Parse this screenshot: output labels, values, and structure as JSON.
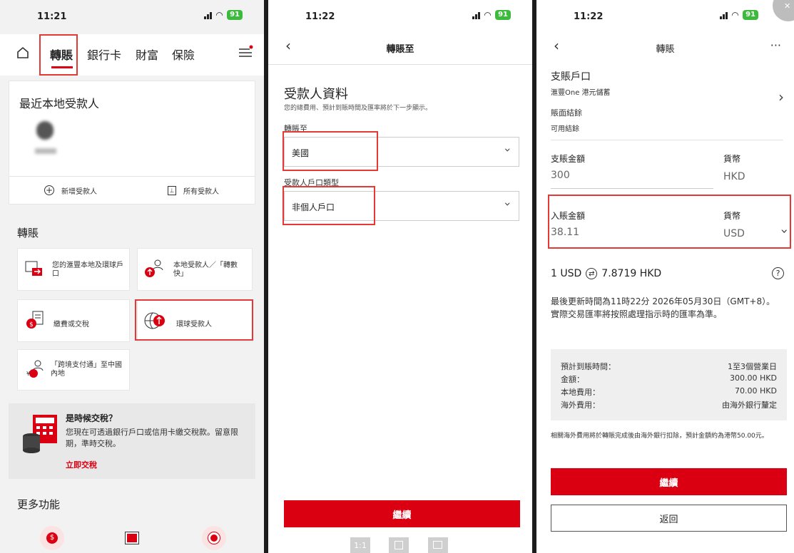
{
  "screen1": {
    "status_time": "11:21",
    "battery": "91",
    "tabs": [
      "轉賬",
      "銀行卡",
      "財富",
      "保險"
    ],
    "recent_title": "最近本地受款人",
    "add_payee": "新增受款人",
    "all_payees": "所有受款人",
    "section_title": "轉賬",
    "tiles": [
      "您的滙豐本地及環球戶口",
      "本地受款人／「轉數快」",
      "繳費或交稅",
      "環球受款人",
      "「跨境支付通」至中國內地"
    ],
    "promo_title": "是時候交稅？",
    "promo_text": "您現在可透過銀行戶口或信用卡繳交稅款。留意限期，準時交稅。",
    "promo_link": "立即交稅",
    "more_title": "更多功能"
  },
  "screen2": {
    "status_time": "11:22",
    "battery": "91",
    "header_title": "轉賬至",
    "section_title": "受款人資料",
    "section_subtitle": "您的總費用、預計到賬時間及匯率將於下一步顯示。",
    "to_label": "轉賬至",
    "to_value": "美國",
    "account_type_label": "受款人戶口類型",
    "account_type_value": "非個人戶口",
    "continue": "繼續",
    "toolbar": [
      "1:1",
      "",
      ""
    ]
  },
  "screen3": {
    "status_time": "11:22",
    "battery": "91",
    "header_title": "轉賬",
    "debit_title": "支賬戶口",
    "debit_account": "滙豐One 港元儲蓄",
    "balance_label": "賬面結餘",
    "available_label": "可用結餘",
    "debit_amount_label": "支賬金額",
    "debit_amount": "300",
    "currency_label": "貨幣",
    "debit_currency": "HKD",
    "credit_amount_label": "入賬金額",
    "credit_amount": "38.11",
    "credit_currency_label": "貨幣",
    "credit_currency": "USD",
    "rate_left": "1 USD",
    "rate_right": "7.8719 HKD",
    "update_text": "最後更新時間為11時22分 2026年05月30日（GMT+8）。實際交易匯率將按照處理指示時的匯率為準。",
    "summary": [
      {
        "label": "預計到賬時間：",
        "value": "1至3個營業日"
      },
      {
        "label": "金額：",
        "value": "300.00 HKD"
      },
      {
        "label": "本地費用：",
        "value": "70.00 HKD"
      },
      {
        "label": "海外費用：",
        "value": "由海外銀行釐定"
      }
    ],
    "fee_note": "相關海外費用將於轉賬完成後由海外銀行扣除，預計金額約為港幣50.00元。",
    "continue": "繼續",
    "back": "返回"
  }
}
